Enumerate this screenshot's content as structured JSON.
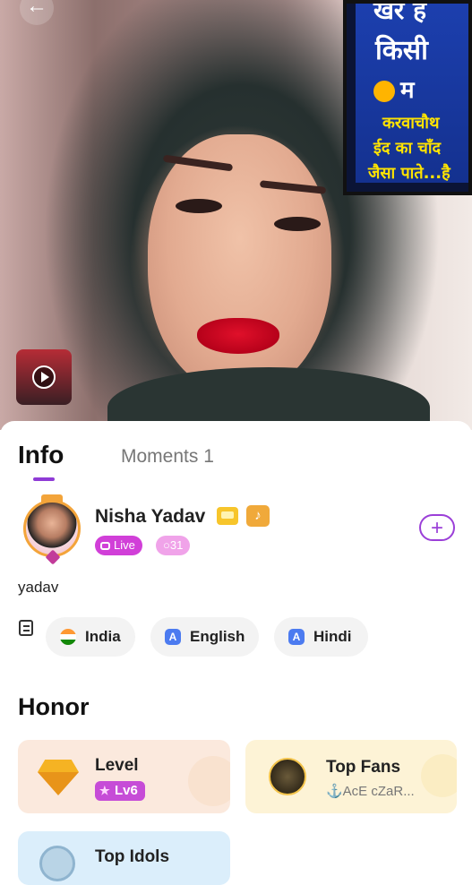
{
  "hero": {
    "back_icon": "arrow-left-icon",
    "poster_lines": [
      "खर ह",
      "किसी",
      "म",
      "करवाचौथ",
      "ईद का चाँद",
      "जैसा पाते...है"
    ],
    "video_thumb_icon": "play-icon"
  },
  "tabs": [
    {
      "label": "Info",
      "active": true
    },
    {
      "label": "Moments 1",
      "active": false
    }
  ],
  "profile": {
    "name": "Nisha Yadav",
    "live_label": "Live",
    "count_label": "31",
    "follow_icon": "plus-icon",
    "bio": "yadav"
  },
  "tags": [
    {
      "label": "India",
      "icon": "india-flag-icon"
    },
    {
      "label": "English",
      "icon": "language-a-icon"
    },
    {
      "label": "Hindi",
      "icon": "language-a-icon"
    }
  ],
  "honor": {
    "title": "Honor",
    "level": {
      "title": "Level",
      "badge": "Lv6"
    },
    "top_fans": {
      "title": "Top Fans",
      "fan_name": "⚓AcE cZaR..."
    },
    "top_idols": {
      "title": "Top Idols"
    }
  },
  "colors": {
    "accent": "#8f3bd6",
    "live": "#d13fd8",
    "level_card": "#fbe9dd",
    "fans_card": "#fdf3d6",
    "idols_card": "#dbeefb"
  }
}
